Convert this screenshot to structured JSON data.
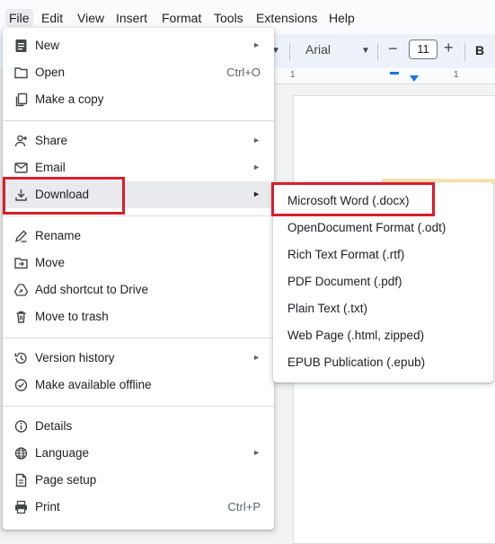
{
  "menubar": {
    "items": [
      "File",
      "Edit",
      "View",
      "Insert",
      "Format",
      "Tools",
      "Extensions",
      "Help"
    ]
  },
  "toolbar": {
    "font": "Arial",
    "font_size": "11",
    "minus": "−",
    "plus": "+",
    "bold": "B"
  },
  "ruler": {
    "labels": [
      "1",
      "1"
    ]
  },
  "file_menu": {
    "items": [
      {
        "label": "New",
        "icon": "new-doc-icon",
        "submenu": true
      },
      {
        "label": "Open",
        "icon": "folder-icon",
        "shortcut": "Ctrl+O"
      },
      {
        "label": "Make a copy",
        "icon": "copy-icon"
      },
      {
        "label": "Share",
        "icon": "share-person-icon",
        "submenu": true
      },
      {
        "label": "Email",
        "icon": "email-icon",
        "submenu": true
      },
      {
        "label": "Download",
        "icon": "download-icon",
        "submenu": true,
        "highlighted": true
      },
      {
        "label": "Rename",
        "icon": "rename-icon"
      },
      {
        "label": "Move",
        "icon": "move-folder-icon"
      },
      {
        "label": "Add shortcut to Drive",
        "icon": "drive-shortcut-icon"
      },
      {
        "label": "Move to trash",
        "icon": "trash-icon"
      },
      {
        "label": "Version history",
        "icon": "history-icon",
        "submenu": true
      },
      {
        "label": "Make available offline",
        "icon": "offline-icon"
      },
      {
        "label": "Details",
        "icon": "info-icon"
      },
      {
        "label": "Language",
        "icon": "globe-icon",
        "submenu": true
      },
      {
        "label": "Page setup",
        "icon": "page-setup-icon"
      },
      {
        "label": "Print",
        "icon": "print-icon",
        "shortcut": "Ctrl+P"
      }
    ],
    "arrow": "►"
  },
  "download_submenu": {
    "items": [
      "Microsoft Word (.docx)",
      "OpenDocument Format (.odt)",
      "Rich Text Format (.rtf)",
      "PDF Document (.pdf)",
      "Plain Text (.txt)",
      "Web Page (.html, zipped)",
      "EPUB Publication (.epub)"
    ]
  },
  "colors": {
    "highlight_box": "#d91e2a",
    "hover_bg": "#e8eaed",
    "accent": "#1a73e8"
  }
}
